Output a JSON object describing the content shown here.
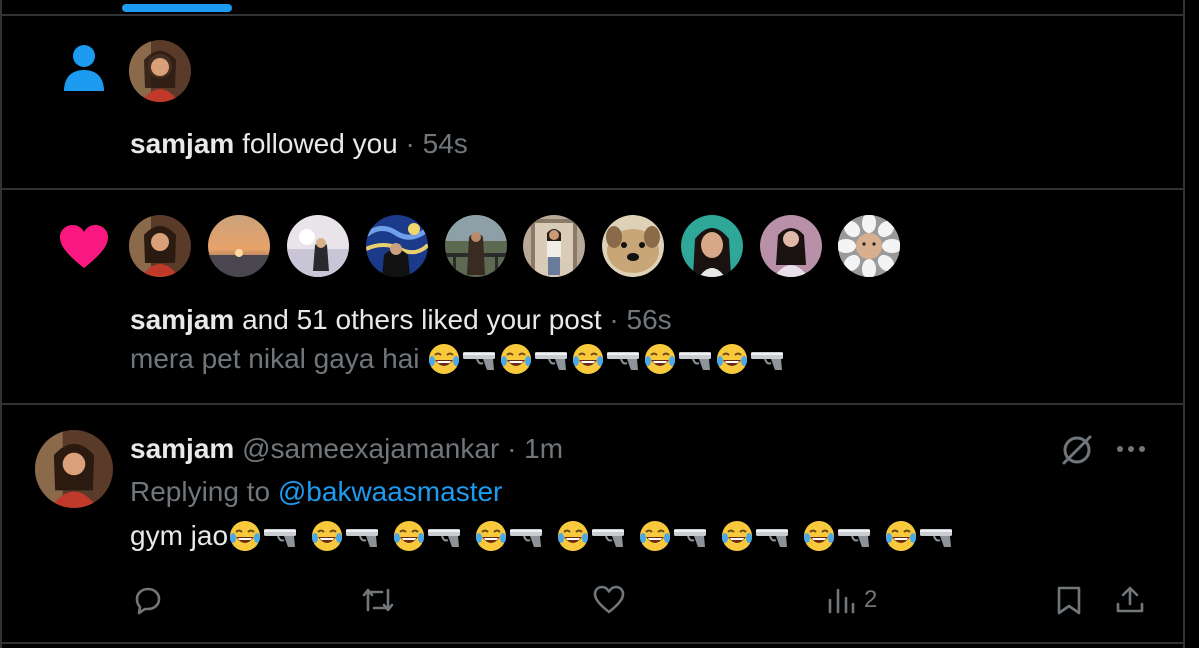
{
  "follow": {
    "user": "samjam",
    "text": "followed you",
    "sep": "·",
    "time": "54s",
    "icon": "person-icon"
  },
  "likes": {
    "user": "samjam",
    "text": "and 51 others liked your post",
    "sep": "·",
    "time": "56s",
    "post_text": "mera pet nikal gaya hai",
    "icon": "heart-icon",
    "avatar_count": 10
  },
  "reply": {
    "name": "samjam",
    "handle": "@sameexajamankar",
    "sep": "·",
    "time": "1m",
    "replying_label": "Replying to",
    "replying_to": "@bakwaasmaster",
    "text": "gym jao",
    "views": "2"
  },
  "colors": {
    "accent": "#1d9bf0",
    "heart": "#f91880",
    "muted": "#71767b",
    "border": "#2f3336"
  }
}
